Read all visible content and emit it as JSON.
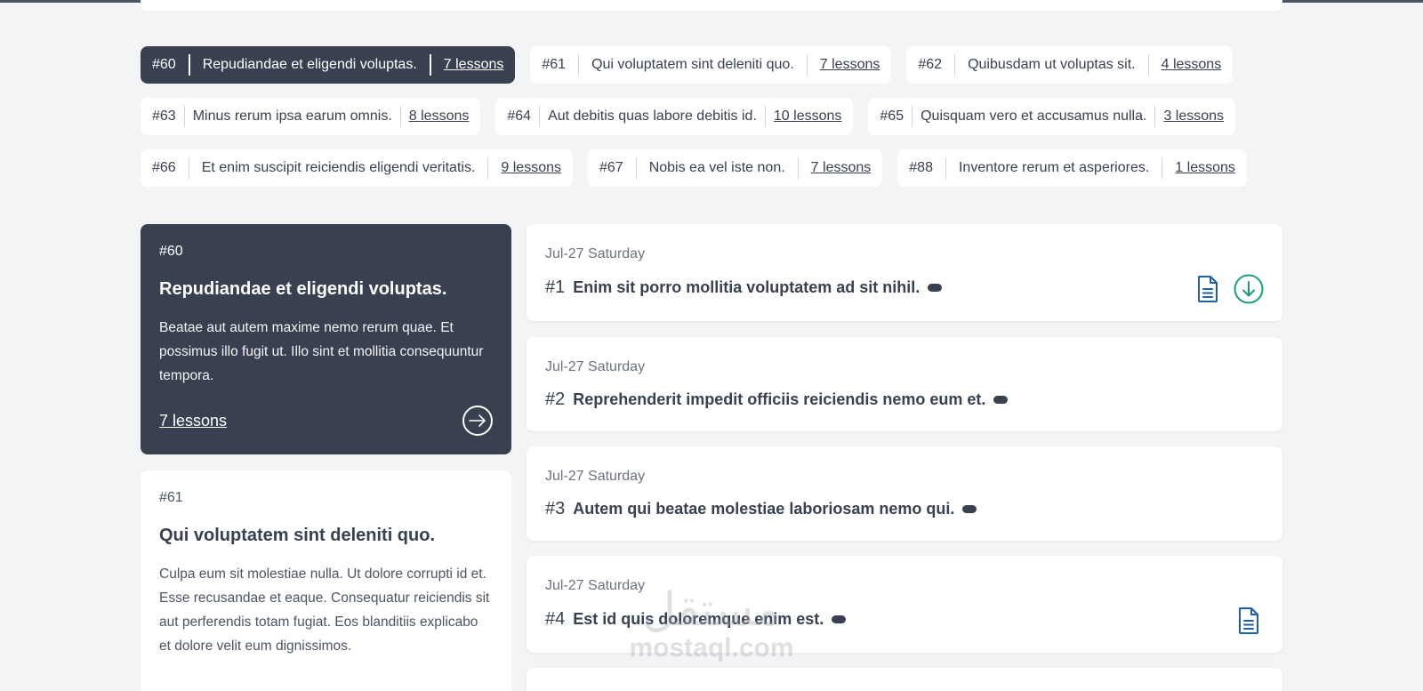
{
  "chips": [
    {
      "num": "#60",
      "title": "Repudiandae et eligendi voluptas.",
      "count": "7 lessons",
      "active": true
    },
    {
      "num": "#61",
      "title": "Qui voluptatem sint deleniti quo.",
      "count": "7 lessons"
    },
    {
      "num": "#62",
      "title": "Quibusdam ut voluptas sit.",
      "count": "4 lessons"
    },
    {
      "num": "#63",
      "title": "Minus rerum ipsa earum omnis.",
      "count": "8 lessons"
    },
    {
      "num": "#64",
      "title": "Aut debitis quas labore debitis id.",
      "count": "10 lessons"
    },
    {
      "num": "#65",
      "title": "Quisquam vero et accusamus nulla.",
      "count": "3 lessons"
    },
    {
      "num": "#66",
      "title": "Et enim suscipit reiciendis eligendi veritatis.",
      "count": "9 lessons"
    },
    {
      "num": "#67",
      "title": "Nobis ea vel iste non.",
      "count": "7 lessons"
    },
    {
      "num": "#88",
      "title": "Inventore rerum et asperiores.",
      "count": "1 lessons"
    }
  ],
  "courses": [
    {
      "num": "#60",
      "title": "Repudiandae et eligendi voluptas.",
      "description": "Beatae aut autem maxime nemo rerum quae. Et possimus illo fugit ut. Illo sint et mollitia consequuntur tempora.",
      "lessons": "7 lessons"
    },
    {
      "num": "#61",
      "title": "Qui voluptatem sint deleniti quo.",
      "description": "Culpa eum sit molestiae nulla. Ut dolore corrupti id et. Esse recusandae et eaque. Consequatur reiciendis sit aut perferendis totam fugiat. Eos blanditiis explicabo et dolore velit eum dignissimos."
    }
  ],
  "lessons": [
    {
      "date": "Jul-27 Saturday",
      "num": "#1",
      "title": "Enim sit porro mollitia voluptatem ad sit nihil.",
      "icons": [
        "document-icon",
        "download-icon"
      ]
    },
    {
      "date": "Jul-27 Saturday",
      "num": "#2",
      "title": "Reprehenderit impedit officiis reiciendis nemo eum et.",
      "icons": []
    },
    {
      "date": "Jul-27 Saturday",
      "num": "#3",
      "title": "Autem qui beatae molestiae laboriosam nemo qui.",
      "icons": []
    },
    {
      "date": "Jul-27 Saturday",
      "num": "#4",
      "title": "Est id quis doloremque enim est.",
      "icons": [
        "document-icon"
      ]
    }
  ],
  "watermark": {
    "arabic": "مستقل",
    "latin": "mostaql.com"
  },
  "colors": {
    "dark": "#394150",
    "doc_icon": "#1d5fa8",
    "download_icon": "#16a06a",
    "background": "#f3f4f6"
  }
}
